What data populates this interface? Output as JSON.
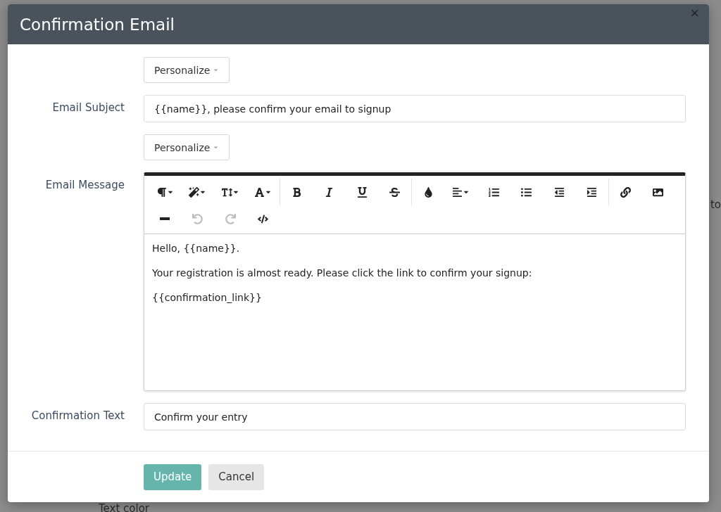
{
  "background": {
    "fragments": [
      {
        "kind": "side",
        "text": "to"
      },
      {
        "kind": "bottom",
        "text": "Text color"
      }
    ]
  },
  "dialog": {
    "title": "Confirmation Email",
    "close": "×"
  },
  "form": {
    "subject_personalize": "Personalize",
    "subject_label": "Email Subject",
    "subject_value": "{{name}}, please confirm your email to signup",
    "message_personalize": "Personalize",
    "message_label": "Email Message",
    "toolbar": {
      "rows": [
        [
          [
            {
              "kind": "paragraph",
              "dropdown": true,
              "disabled": false
            },
            {
              "kind": "magic",
              "dropdown": true,
              "disabled": false
            },
            {
              "kind": "text-height",
              "dropdown": true,
              "disabled": false
            },
            {
              "kind": "font",
              "dropdown": true,
              "disabled": false
            }
          ],
          [
            {
              "kind": "bold",
              "dropdown": false,
              "disabled": false
            },
            {
              "kind": "italic",
              "dropdown": false,
              "disabled": false
            },
            {
              "kind": "underline",
              "dropdown": false,
              "disabled": false
            },
            {
              "kind": "strikethrough",
              "dropdown": false,
              "disabled": false
            }
          ],
          [
            {
              "kind": "color",
              "dropdown": false,
              "disabled": false
            },
            {
              "kind": "align",
              "dropdown": true,
              "disabled": false
            },
            {
              "kind": "ordered-list",
              "dropdown": false,
              "disabled": false
            },
            {
              "kind": "bullet-list",
              "dropdown": false,
              "disabled": false
            },
            {
              "kind": "outdent",
              "dropdown": false,
              "disabled": false
            },
            {
              "kind": "indent",
              "dropdown": false,
              "disabled": false
            }
          ],
          [
            {
              "kind": "link",
              "dropdown": false,
              "disabled": false
            },
            {
              "kind": "image",
              "dropdown": false,
              "disabled": false
            }
          ]
        ],
        [
          [
            {
              "kind": "rule",
              "dropdown": false,
              "disabled": false
            },
            {
              "kind": "undo",
              "dropdown": false,
              "disabled": true
            },
            {
              "kind": "redo",
              "dropdown": false,
              "disabled": true
            },
            {
              "kind": "code",
              "dropdown": false,
              "disabled": false
            }
          ]
        ]
      ]
    },
    "message_paragraphs": [
      "Hello, {{name}}.",
      "Your registration is almost ready. Please click the link to confirm your signup:",
      "{{confirmation_link}}"
    ],
    "confirmation_label": "Confirmation Text",
    "confirmation_value": "Confirm your entry"
  },
  "buttons": [
    {
      "kind": "primary",
      "label": "Update"
    },
    {
      "kind": "secondary",
      "label": "Cancel"
    }
  ]
}
